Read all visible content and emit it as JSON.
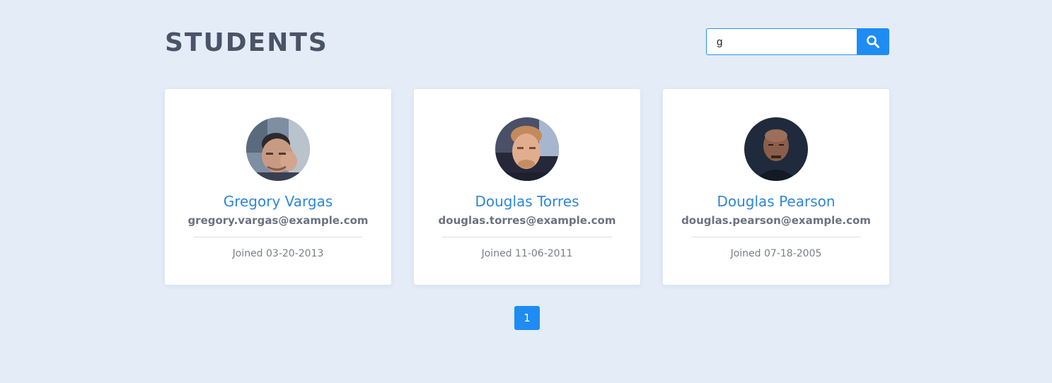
{
  "header": {
    "title": "STUDENTS"
  },
  "search": {
    "value": "g",
    "icon": "search-icon"
  },
  "students": [
    {
      "name": "Gregory Vargas",
      "email": "gregory.vargas@example.com",
      "joined": "Joined 03-20-2013"
    },
    {
      "name": "Douglas Torres",
      "email": "douglas.torres@example.com",
      "joined": "Joined 11-06-2011"
    },
    {
      "name": "Douglas Pearson",
      "email": "douglas.pearson@example.com",
      "joined": "Joined 07-18-2005"
    }
  ],
  "pagination": {
    "pages": [
      "1"
    ],
    "current": "1"
  },
  "colors": {
    "background": "#e4ecf8",
    "accent": "#1e8cf2",
    "name": "#2f86d8",
    "title": "#4a5467"
  }
}
